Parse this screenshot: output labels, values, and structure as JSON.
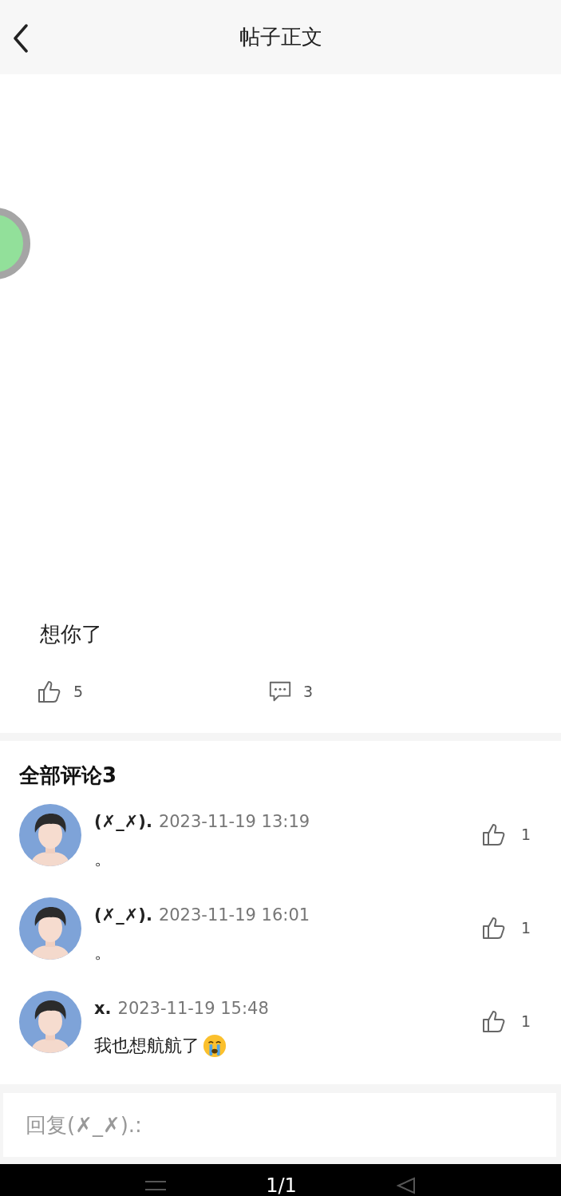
{
  "header": {
    "title": "帖子正文"
  },
  "post": {
    "text": "想你了",
    "likes": "5",
    "comments": "3"
  },
  "comments_section": {
    "title": "全部评论3",
    "comments": [
      {
        "author": "(✗_✗).",
        "time": "2023-11-19 13:19",
        "text": "。",
        "likes": "1",
        "emoji": false
      },
      {
        "author": "(✗_✗).",
        "time": "2023-11-19 16:01",
        "text": "。",
        "likes": "1",
        "emoji": false
      },
      {
        "author": "x.",
        "time": "2023-11-19 15:48",
        "text": "我也想航航了",
        "likes": "1",
        "emoji": true
      }
    ]
  },
  "reply": {
    "placeholder": "回复(✗_✗).:"
  },
  "nav_bar": {
    "page_indicator": "1/1"
  }
}
